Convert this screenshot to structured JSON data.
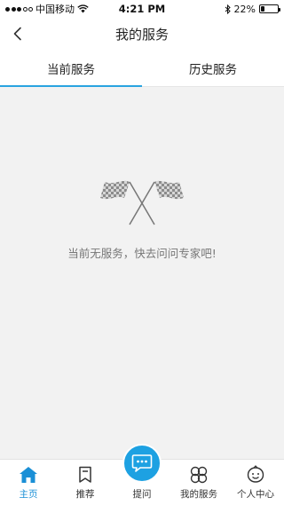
{
  "status_bar": {
    "carrier": "中国移动",
    "time": "4:21 PM",
    "battery_text": "22%",
    "battery_level": 0.22,
    "icons": [
      "signal-dots-icon",
      "wifi-icon",
      "bluetooth-icon",
      "battery-icon"
    ]
  },
  "nav": {
    "title": "我的服务",
    "back_icon": "chevron-left-icon"
  },
  "tabs": [
    {
      "label": "当前服务",
      "active": true
    },
    {
      "label": "历史服务",
      "active": false
    }
  ],
  "empty_state": {
    "icon": "checkered-flags-icon",
    "message": "当前无服务，快去问问专家吧!"
  },
  "tab_bar": {
    "items": [
      {
        "label": "主页",
        "icon": "home-icon",
        "active": true
      },
      {
        "label": "推荐",
        "icon": "bookmark-icon",
        "active": false
      },
      {
        "label": "提问",
        "icon": "chat-bubble-icon",
        "active": false
      },
      {
        "label": "我的服务",
        "icon": "clover-icon",
        "active": false
      },
      {
        "label": "个人中心",
        "icon": "smiley-icon",
        "active": false
      }
    ]
  },
  "colors": {
    "accent": "#1da1e2",
    "tab_active_underline": "#29a3e0",
    "background": "#f2f2f2"
  }
}
